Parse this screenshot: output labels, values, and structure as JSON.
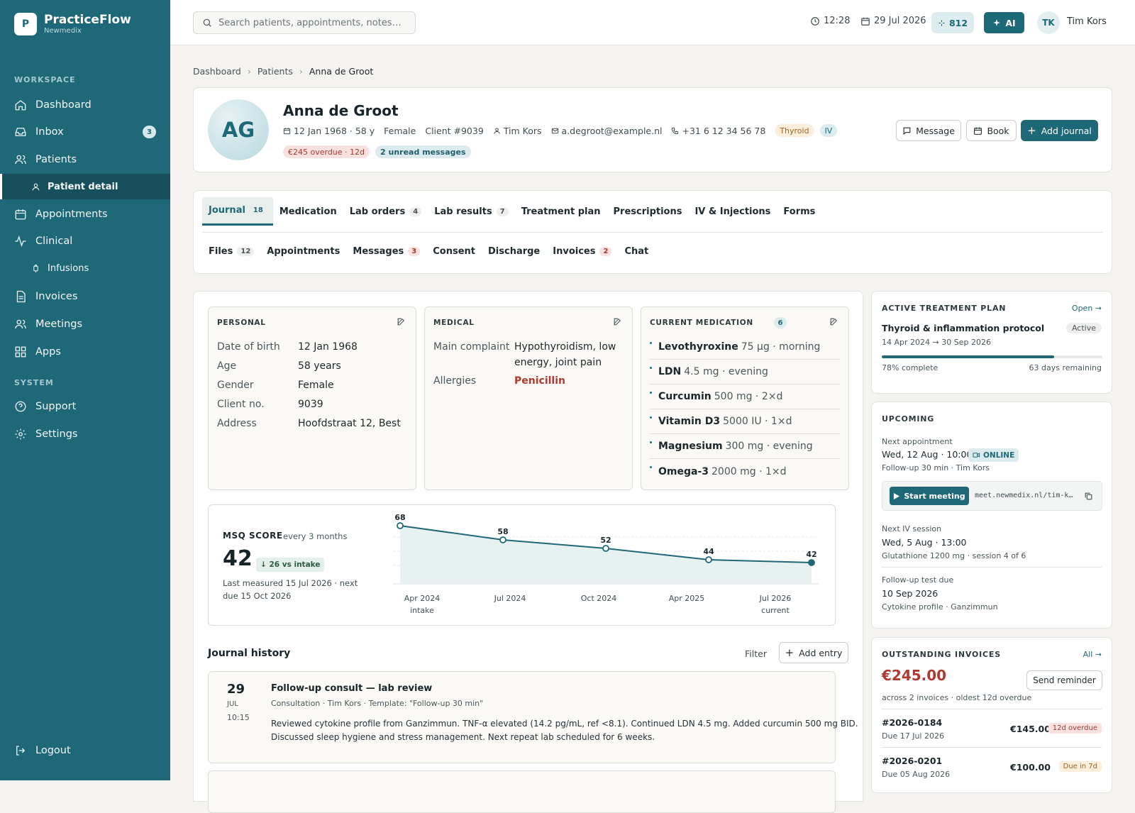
{
  "app": {
    "name": "PracticeFlow",
    "sub": "Newmedix",
    "logo_letter": "P"
  },
  "sidebar": {
    "workspace_label": "WORKSPACE",
    "system_label": "SYSTEM",
    "items": [
      {
        "label": "Dashboard"
      },
      {
        "label": "Inbox",
        "badge": "3"
      },
      {
        "label": "Patients"
      },
      {
        "label": "Patient detail"
      },
      {
        "label": "Appointments"
      },
      {
        "label": "Clinical"
      },
      {
        "label": "Infusions"
      },
      {
        "label": "Invoices"
      },
      {
        "label": "Meetings"
      },
      {
        "label": "Apps"
      },
      {
        "label": "Support"
      },
      {
        "label": "Settings"
      },
      {
        "label": "Logout"
      }
    ]
  },
  "topbar": {
    "search_placeholder": "Search patients, appointments, notes…",
    "time": "12:28",
    "date": "29 Jul 2026",
    "score": "812",
    "ai": "AI",
    "user_initials": "TK",
    "user_name": "Tim Kors"
  },
  "breadcrumb": [
    "Dashboard",
    "Patients",
    "Anna de Groot"
  ],
  "patient": {
    "initials": "AG",
    "name": "Anna de Groot",
    "dob": "12 Jan 1968 · 58 y",
    "gender": "Female",
    "client": "Client #9039",
    "practitioner": "Tim Kors",
    "email": "a.degroot@example.nl",
    "phone": "+31 6 12 34 56 78",
    "tags": [
      "Thyroid",
      "IV"
    ],
    "alert_overdue": "€245 overdue · 12d",
    "alert_messages": "2 unread messages",
    "btn_message": "Message",
    "btn_book": "Book",
    "btn_journal": "Add journal"
  },
  "tabs_row1": [
    {
      "label": "Journal",
      "count": "18"
    },
    {
      "label": "Medication",
      "count": ""
    },
    {
      "label": "Lab orders",
      "count": "4"
    },
    {
      "label": "Lab results",
      "count": "7"
    },
    {
      "label": "Treatment plan",
      "count": ""
    },
    {
      "label": "Prescriptions",
      "count": ""
    },
    {
      "label": "IV & Injections",
      "count": ""
    },
    {
      "label": "Forms",
      "count": ""
    }
  ],
  "tabs_row2": [
    {
      "label": "Files",
      "count": "12"
    },
    {
      "label": "Appointments",
      "count": ""
    },
    {
      "label": "Messages",
      "count": "3"
    },
    {
      "label": "Consent",
      "count": ""
    },
    {
      "label": "Discharge",
      "count": ""
    },
    {
      "label": "Invoices",
      "count": "2"
    },
    {
      "label": "Chat",
      "count": ""
    }
  ],
  "personal": {
    "title": "PERSONAL",
    "rows": [
      {
        "k": "Date of birth",
        "v": "12 Jan 1968"
      },
      {
        "k": "Age",
        "v": "58 years"
      },
      {
        "k": "Gender",
        "v": "Female"
      },
      {
        "k": "Client no.",
        "v": "9039"
      },
      {
        "k": "Address",
        "v": "Hoofdstraat 12, Best"
      }
    ]
  },
  "medical": {
    "title": "MEDICAL",
    "complaint_k": "Main complaint",
    "complaint_v1": "Hypothyroidism, low",
    "complaint_v2": "energy, joint pain",
    "allergies_k": "Allergies",
    "allergies_v": "Penicillin"
  },
  "medication": {
    "title": "CURRENT MEDICATION",
    "count": "6",
    "items": [
      {
        "name": "Levothyroxine",
        "dose": "75 µg · morning"
      },
      {
        "name": "LDN",
        "dose": "4.5 mg · evening"
      },
      {
        "name": "Curcumin",
        "dose": "500 mg · 2×d"
      },
      {
        "name": "Vitamin D3",
        "dose": "5000 IU · 1×d"
      },
      {
        "name": "Magnesium",
        "dose": "300 mg · evening"
      },
      {
        "name": "Omega-3",
        "dose": "2000 mg · 1×d"
      }
    ]
  },
  "msq": {
    "title": "MSQ SCORE",
    "freq": "every 3 months",
    "score": "42",
    "delta": "↓ 26 vs intake",
    "note1": "Last measured 15 Jul 2026 · next",
    "note2": "due 15 Oct 2026"
  },
  "chart_data": {
    "type": "line",
    "title": "",
    "series": [
      {
        "values": [
          68,
          58,
          52,
          44,
          42
        ]
      }
    ],
    "x": [
      "Apr 2024",
      "Jul 2024",
      "Oct 2024",
      "Apr 2025",
      "Jul 2026"
    ],
    "x_sublabels": [
      "intake",
      "",
      "",
      "",
      "current"
    ],
    "ylim": [
      30,
      70
    ],
    "grid": true
  },
  "journal": {
    "title": "Journal history",
    "filter": "Filter",
    "add": "Add entry",
    "entry": {
      "day": "29",
      "month": "JUL",
      "time": "10:15",
      "title": "Follow-up consult — lab review",
      "meta": "Consultation · Tim Kors · Template: \"Follow-up 30 min\"",
      "body1": "Reviewed cytokine profile from Ganzimmun. TNF-α elevated (14.2 pg/mL, ref <8.1). Continued LDN 4.5 mg. Added curcumin 500 mg BID.",
      "body2": "Discussed sleep hygiene and stress management. Next repeat lab scheduled for 6 weeks."
    }
  },
  "plan": {
    "title": "ACTIVE TREATMENT PLAN",
    "open": "Open →",
    "name": "Thyroid & inflammation protocol",
    "status": "Active",
    "dates": "14 Apr 2024 → 30 Sep 2026",
    "progress": 0.78,
    "complete": "78% complete",
    "remaining": "63 days remaining"
  },
  "upcoming": {
    "title": "UPCOMING",
    "appt_label": "Next appointment",
    "appt_when": "Wed, 12 Aug · 10:00",
    "online": "ONLINE",
    "appt_detail": "Follow-up 30 min · Tim Kors",
    "start": "Start meeting",
    "link": "meet.newmedix.nl/tim-k…",
    "iv_label": "Next IV session",
    "iv_when": "Wed, 5 Aug · 13:00",
    "iv_detail": "Glutathione 1200 mg · session 4 of 6",
    "test_label": "Follow-up test due",
    "test_when": "10 Sep 2026",
    "test_detail": "Cytokine profile · Ganzimmun"
  },
  "invoices": {
    "title": "OUTSTANDING INVOICES",
    "all": "All →",
    "total": "€245.00",
    "reminder": "Send reminder",
    "summary": "across 2 invoices · oldest 12d overdue",
    "items": [
      {
        "id": "#2026-0184",
        "due": "Due 17 Jul 2026",
        "amount": "€145.00",
        "status": "12d overdue"
      },
      {
        "id": "#2026-0201",
        "due": "Due 05 Aug 2026",
        "amount": "€100.00",
        "status": "Due in 7d"
      }
    ]
  },
  "colors": {
    "brand": "#1f6878",
    "danger": "#b03a31",
    "sidebar": "#1f6878"
  }
}
